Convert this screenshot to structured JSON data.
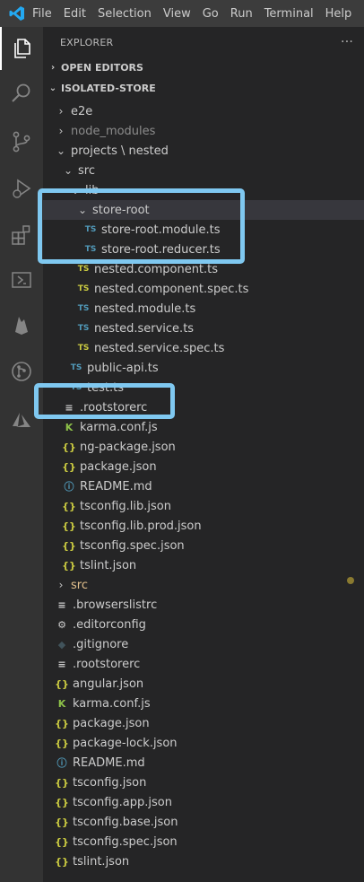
{
  "menu": [
    "File",
    "Edit",
    "Selection",
    "View",
    "Go",
    "Run",
    "Terminal",
    "Help"
  ],
  "explorer": {
    "title": "EXPLORER",
    "more": "···"
  },
  "sections": {
    "open_editors": "OPEN EDITORS",
    "workspace": "ISOLATED-STORE"
  },
  "tree": [
    {
      "label": "e2e",
      "icon": "",
      "chev": "›"
    },
    {
      "label": "node_modules",
      "icon": "",
      "chev": "›"
    },
    {
      "label": "projects \\ nested",
      "icon": "",
      "chev": "⌄"
    },
    {
      "label": "src",
      "icon": "",
      "chev": "⌄"
    },
    {
      "label": "lib",
      "icon": "",
      "chev": "⌄"
    },
    {
      "label": "store-root",
      "icon": "",
      "chev": "⌄"
    },
    {
      "label": "store-root.module.ts",
      "icon": "TS",
      "chev": ""
    },
    {
      "label": "store-root.reducer.ts",
      "icon": "TS",
      "chev": ""
    },
    {
      "label": "nested.component.ts",
      "icon": "TS",
      "chev": ""
    },
    {
      "label": "nested.component.spec.ts",
      "icon": "TS",
      "chev": ""
    },
    {
      "label": "nested.module.ts",
      "icon": "TS",
      "chev": ""
    },
    {
      "label": "nested.service.ts",
      "icon": "TS",
      "chev": ""
    },
    {
      "label": "nested.service.spec.ts",
      "icon": "TS",
      "chev": ""
    },
    {
      "label": "public-api.ts",
      "icon": "TS",
      "chev": ""
    },
    {
      "label": "test.ts",
      "icon": "TS",
      "chev": ""
    },
    {
      "label": ".rootstorerc",
      "icon": "≡",
      "chev": ""
    },
    {
      "label": "karma.conf.js",
      "icon": "K",
      "chev": ""
    },
    {
      "label": "ng-package.json",
      "icon": "{}",
      "chev": ""
    },
    {
      "label": "package.json",
      "icon": "{}",
      "chev": ""
    },
    {
      "label": "README.md",
      "icon": "ⓘ",
      "chev": ""
    },
    {
      "label": "tsconfig.lib.json",
      "icon": "{}",
      "chev": ""
    },
    {
      "label": "tsconfig.lib.prod.json",
      "icon": "{}",
      "chev": ""
    },
    {
      "label": "tsconfig.spec.json",
      "icon": "{}",
      "chev": ""
    },
    {
      "label": "tslint.json",
      "icon": "{}",
      "chev": ""
    },
    {
      "label": "src",
      "icon": "",
      "chev": "›"
    },
    {
      "label": ".browserslistrc",
      "icon": "≡",
      "chev": ""
    },
    {
      "label": ".editorconfig",
      "icon": "⚙",
      "chev": ""
    },
    {
      "label": ".gitignore",
      "icon": "◆",
      "chev": ""
    },
    {
      "label": ".rootstorerc",
      "icon": "≡",
      "chev": ""
    },
    {
      "label": "angular.json",
      "icon": "{}",
      "chev": ""
    },
    {
      "label": "karma.conf.js",
      "icon": "K",
      "chev": ""
    },
    {
      "label": "package.json",
      "icon": "{}",
      "chev": ""
    },
    {
      "label": "package-lock.json",
      "icon": "{}",
      "chev": ""
    },
    {
      "label": "README.md",
      "icon": "ⓘ",
      "chev": ""
    },
    {
      "label": "tsconfig.json",
      "icon": "{}",
      "chev": ""
    },
    {
      "label": "tsconfig.app.json",
      "icon": "{}",
      "chev": ""
    },
    {
      "label": "tsconfig.base.json",
      "icon": "{}",
      "chev": ""
    },
    {
      "label": "tsconfig.spec.json",
      "icon": "{}",
      "chev": ""
    },
    {
      "label": "tslint.json",
      "icon": "{}",
      "chev": ""
    }
  ],
  "colors": {
    "highlight": "#7fc8f0",
    "ts": "#519aba",
    "json": "#cbcb41",
    "karma": "#8dc149",
    "info": "#519aba",
    "src_folder": "#e2c08d"
  }
}
